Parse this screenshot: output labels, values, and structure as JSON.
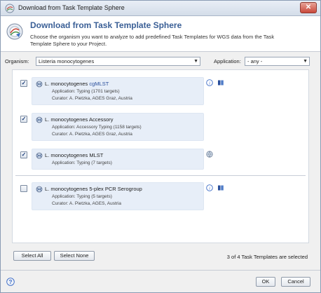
{
  "window": {
    "title": "Download from Task Template Sphere",
    "close_glyph": "✕"
  },
  "header": {
    "title": "Download from Task Template Sphere",
    "description": "Choose the organism you want to analyze to add predefined Task Templates for WGS data from the Task Template Sphere to your Project."
  },
  "filters": {
    "organism_label": "Organism:",
    "organism_value": "Listeria monocytogenes",
    "application_label": "Application:",
    "application_value": "- any -"
  },
  "templates": [
    {
      "checked": true,
      "title_prefix": "L. monocytogenes ",
      "title_link": "cgMLST",
      "application": "Application: Typing (1701 targets)",
      "curator": "Curator: A. Pietzka, AGES Graz, Austria",
      "side_icons": [
        "info-icon",
        "book-icon"
      ]
    },
    {
      "checked": true,
      "title_prefix": "L. monocytogenes Accessory",
      "title_link": "",
      "application": "Application: Accessory Typing (1158 targets)",
      "curator": "Curator: A. Pietzka, AGES Graz, Austria",
      "side_icons": []
    },
    {
      "checked": true,
      "title_prefix": "L. monocytogenes MLST",
      "title_link": "",
      "application": "Application: Typing (7 targets)",
      "curator": "",
      "side_icons": [
        "globe-icon"
      ]
    },
    {
      "checked": false,
      "title_prefix": "L. monocytogenes 5-plex PCR Serogroup",
      "title_link": "",
      "application": "Application: Typing (5 targets)",
      "curator": "Curator: A. Pietzka, AGES, Austria",
      "side_icons": [
        "info-icon",
        "book-icon"
      ]
    }
  ],
  "actions": {
    "select_all": "Select All",
    "select_none": "Select None",
    "status": "3 of 4 Task Templates are selected"
  },
  "footer": {
    "ok": "OK",
    "cancel": "Cancel"
  },
  "colors": {
    "accent": "#3a5f96",
    "card_bg": "#e7eef8",
    "link": "#2a4f9c"
  }
}
